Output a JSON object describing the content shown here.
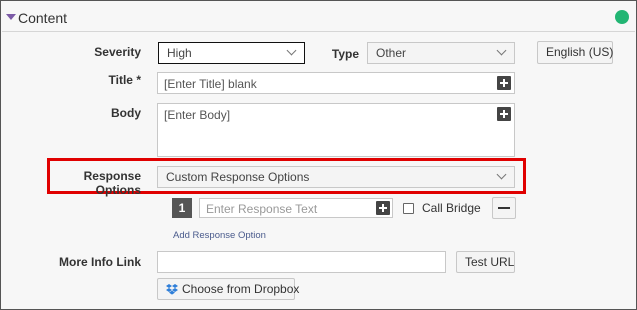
{
  "panel": {
    "title": "Content",
    "status_color": "#22b573",
    "accent_color": "#7b5aa6"
  },
  "severity": {
    "label": "Severity",
    "value": "High"
  },
  "type": {
    "label": "Type",
    "value": "Other"
  },
  "language": {
    "label": "English (US)"
  },
  "title_field": {
    "label": "Title *",
    "value": "[Enter Title] blank"
  },
  "body_field": {
    "label": "Body",
    "value": "[Enter Body]"
  },
  "response_options": {
    "label": "Response Options",
    "value": "Custom Response Options",
    "highlight_color": "#e00000"
  },
  "response_item": {
    "number": "1",
    "placeholder": "Enter Response Text",
    "call_bridge_label": "Call Bridge"
  },
  "add_response_option": "Add Response Option",
  "more_info": {
    "label": "More Info Link",
    "value": "",
    "test_url": "Test URL",
    "dropbox": "Choose from Dropbox"
  }
}
